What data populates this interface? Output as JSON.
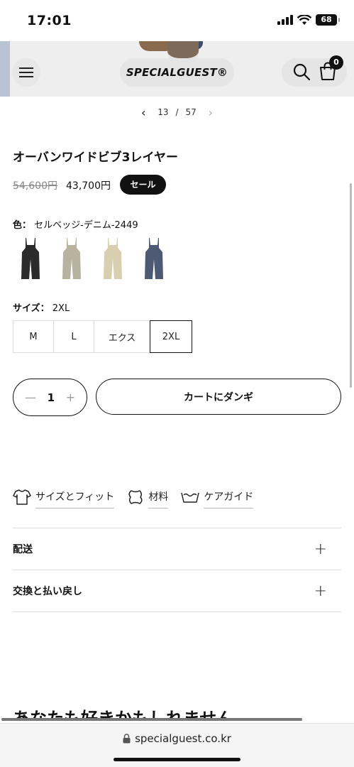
{
  "status_bar": {
    "time": "17:01",
    "battery": "68"
  },
  "header": {
    "brand": "SPECIALGUEST®",
    "cart_count": "0"
  },
  "gallery": {
    "current": "13",
    "separator": "/",
    "total": "57"
  },
  "product": {
    "title": "オーバンワイドビブ3レイヤー",
    "price_original": "54,600円",
    "price_sale": "43,700円",
    "sale_badge": "セール",
    "color_label": "色：",
    "color_value": "セルベッジ-デニム-2449",
    "swatches": [
      {
        "name": "black",
        "color": "#2b2b2b"
      },
      {
        "name": "khaki",
        "color": "#b7b39f"
      },
      {
        "name": "beige",
        "color": "#d9ceb0"
      },
      {
        "name": "denim",
        "color": "#4c5a74"
      }
    ],
    "size_label": "サイズ：",
    "size_value": "2XL",
    "sizes": [
      "M",
      "L",
      "エクス",
      "2XL"
    ],
    "quantity": "1",
    "add_to_cart": "カートにダンギ"
  },
  "info_links": [
    "サイズとフィット",
    "材料",
    "ケアガイド"
  ],
  "accordions": [
    "配送",
    "交換と払い戻し"
  ],
  "recommend_title": "あなたも好きかもしれません",
  "browser": {
    "url": "specialguest.co.kr"
  }
}
